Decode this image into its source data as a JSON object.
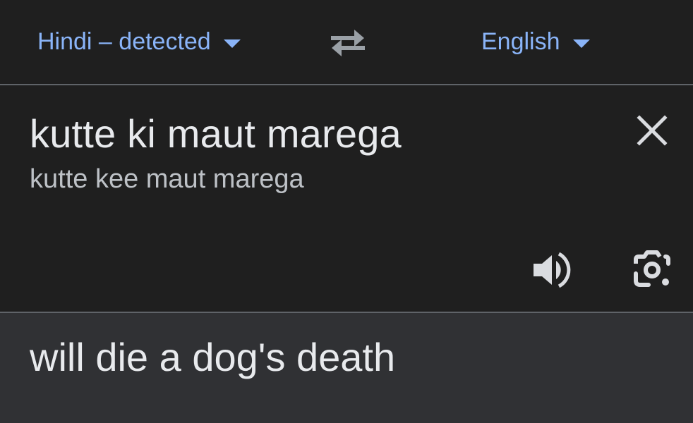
{
  "language_bar": {
    "source_language": "Hindi – detected",
    "target_language": "English",
    "swap_icon": "swap-arrows-icon",
    "caret_icon": "caret-down-icon",
    "accent_color": "#8ab4f8"
  },
  "input": {
    "text": "kutte ki maut marega",
    "transliteration": "kutte kee maut marega",
    "clear_icon": "close-icon",
    "speaker_icon": "speaker-icon",
    "camera_icon": "camera-lens-icon"
  },
  "output": {
    "translation": "will die a dog's death"
  },
  "colors": {
    "background": "#1f1f1f",
    "result_background": "#303134",
    "text_primary": "#e8eaed",
    "text_secondary": "#bdc1c6",
    "icon": "#dadce0"
  }
}
